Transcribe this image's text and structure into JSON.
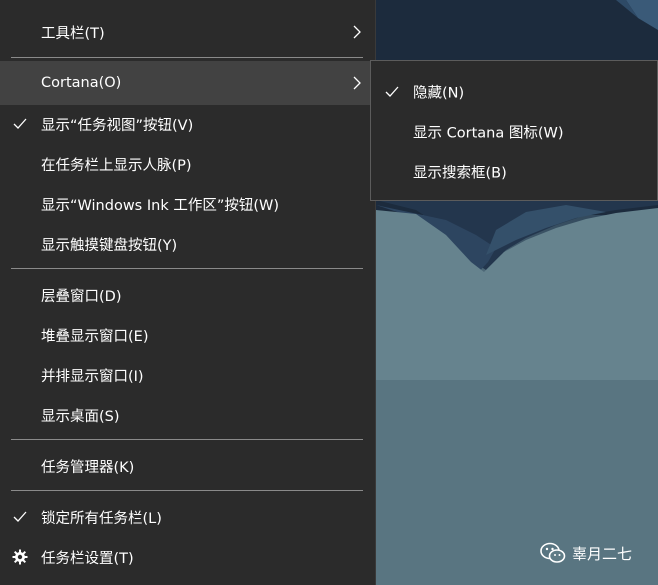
{
  "menu": {
    "items": [
      {
        "label": "工具栏(T)",
        "has_submenu": true,
        "checked": false
      },
      {
        "label": "Cortana(O)",
        "has_submenu": true,
        "checked": false,
        "highlighted": true
      },
      {
        "label": "显示“任务视图”按钮(V)",
        "has_submenu": false,
        "checked": true
      },
      {
        "label": "在任务栏上显示人脉(P)",
        "has_submenu": false,
        "checked": false
      },
      {
        "label": "显示“Windows Ink 工作区”按钮(W)",
        "has_submenu": false,
        "checked": false
      },
      {
        "label": "显示触摸键盘按钮(Y)",
        "has_submenu": false,
        "checked": false
      },
      {
        "label": "层叠窗口(D)",
        "has_submenu": false,
        "checked": false
      },
      {
        "label": "堆叠显示窗口(E)",
        "has_submenu": false,
        "checked": false
      },
      {
        "label": "并排显示窗口(I)",
        "has_submenu": false,
        "checked": false
      },
      {
        "label": "显示桌面(S)",
        "has_submenu": false,
        "checked": false
      },
      {
        "label": "任务管理器(K)",
        "has_submenu": false,
        "checked": false
      },
      {
        "label": "锁定所有任务栏(L)",
        "has_submenu": false,
        "checked": true
      },
      {
        "label": "任务栏设置(T)",
        "has_submenu": false,
        "checked": false,
        "icon": "gear-icon"
      }
    ]
  },
  "submenu": {
    "items": [
      {
        "label": "隐藏(N)",
        "checked": true
      },
      {
        "label": "显示 Cortana 图标(W)",
        "checked": false
      },
      {
        "label": "显示搜索框(B)",
        "checked": false
      }
    ]
  },
  "watermark": {
    "icon": "wechat-icon",
    "text": "辜月二七"
  },
  "colors": {
    "menu_background": "#2b2b2b",
    "highlight": "#424242",
    "separator": "#8a8a8a",
    "text": "#ffffff"
  }
}
